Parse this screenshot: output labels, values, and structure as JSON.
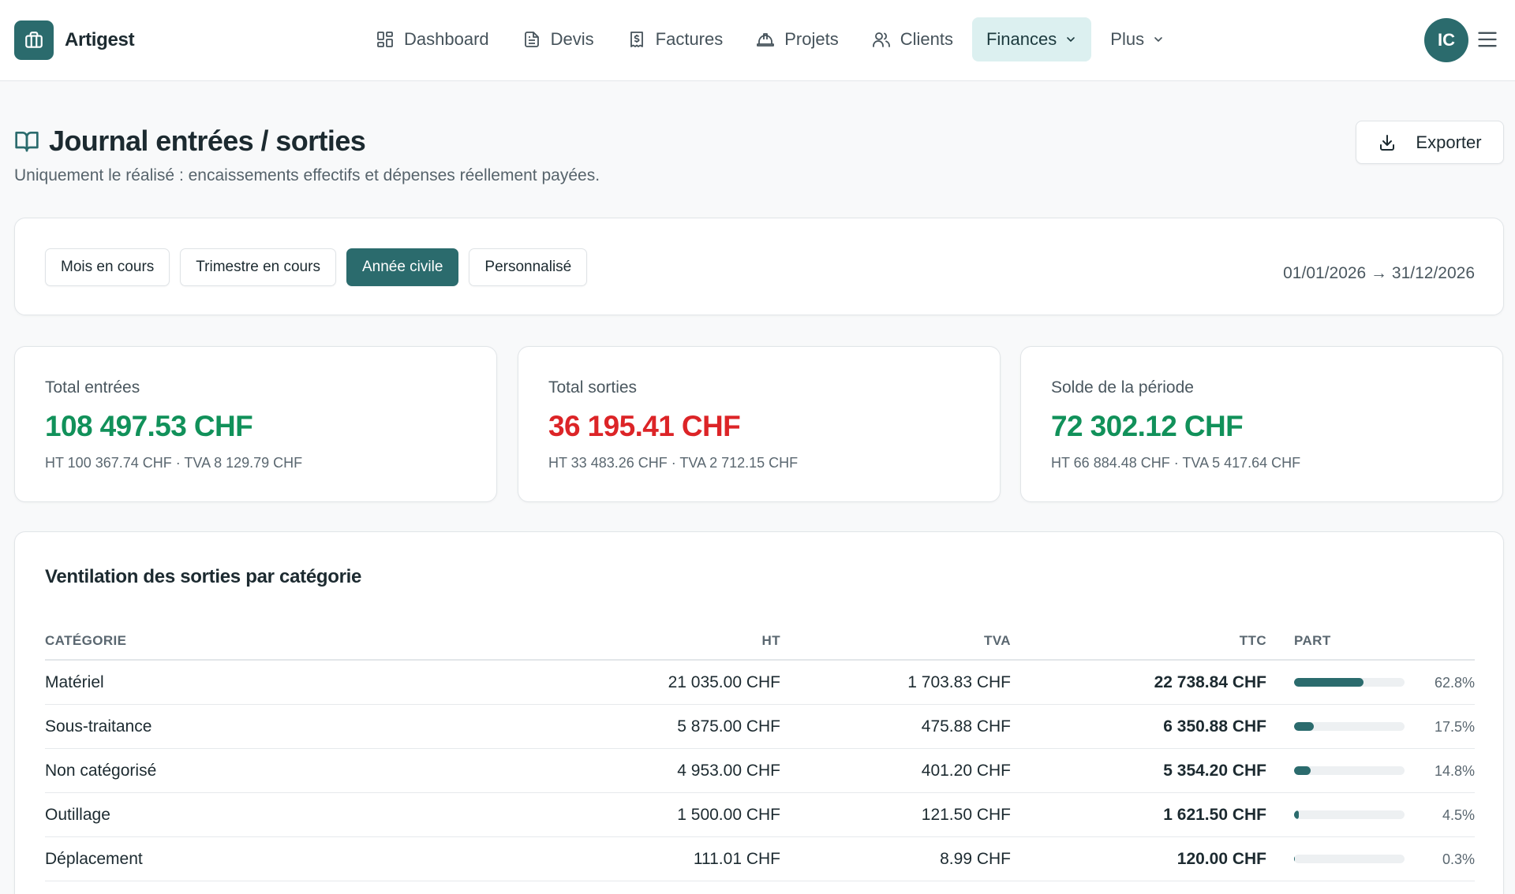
{
  "brand": {
    "name": "Artigest"
  },
  "nav": {
    "items": [
      {
        "label": "Dashboard"
      },
      {
        "label": "Devis"
      },
      {
        "label": "Factures"
      },
      {
        "label": "Projets"
      },
      {
        "label": "Clients"
      },
      {
        "label": "Finances"
      },
      {
        "label": "Plus"
      }
    ]
  },
  "user": {
    "initials": "IC"
  },
  "header": {
    "title": "Journal entrées / sorties",
    "subtitle": "Uniquement le réalisé : encaissements effectifs et dépenses réellement payées.",
    "export_label": "Exporter"
  },
  "period": {
    "options": [
      "Mois en cours",
      "Trimestre en cours",
      "Année civile",
      "Personnalisé"
    ],
    "selected": "Année civile",
    "range": "01/01/2026 → 31/12/2026"
  },
  "stats": {
    "entrees": {
      "label": "Total entrées",
      "value": "108 497.53 CHF",
      "detail": "HT 100 367.74 CHF · TVA 8 129.79 CHF"
    },
    "sorties": {
      "label": "Total sorties",
      "value": "36 195.41 CHF",
      "detail": "HT 33 483.26 CHF · TVA 2 712.15 CHF"
    },
    "solde": {
      "label": "Solde de la période",
      "value": "72 302.12 CHF",
      "detail": "HT 66 884.48 CHF · TVA 5 417.64 CHF"
    }
  },
  "breakdown": {
    "title": "Ventilation des sorties par catégorie",
    "columns": {
      "category": "CATÉGORIE",
      "ht": "HT",
      "tva": "TVA",
      "ttc": "TTC",
      "part": "PART"
    },
    "rows": [
      {
        "category": "Matériel",
        "ht": "21 035.00 CHF",
        "tva": "1 703.83 CHF",
        "ttc": "22 738.84 CHF",
        "part": "62.8%",
        "share": 0.628
      },
      {
        "category": "Sous-traitance",
        "ht": "5 875.00 CHF",
        "tva": "475.88 CHF",
        "ttc": "6 350.88 CHF",
        "part": "17.5%",
        "share": 0.175
      },
      {
        "category": "Non catégorisé",
        "ht": "4 953.00 CHF",
        "tva": "401.20 CHF",
        "ttc": "5 354.20 CHF",
        "part": "14.8%",
        "share": 0.148
      },
      {
        "category": "Outillage",
        "ht": "1 500.00 CHF",
        "tva": "121.50 CHF",
        "ttc": "1 621.50 CHF",
        "part": "4.5%",
        "share": 0.045
      },
      {
        "category": "Déplacement",
        "ht": "111.01 CHF",
        "tva": "8.99 CHF",
        "ttc": "120.00 CHF",
        "part": "0.3%",
        "share": 0.003
      }
    ]
  },
  "colors": {
    "accent": "#2b6b6d",
    "positive": "#11915a",
    "negative": "#dc2427",
    "nav_active_bg": "#dcf0f0"
  },
  "icons": {
    "brand": "briefcase-icon",
    "dashboard": "layout-grid-icon",
    "devis": "file-text-icon",
    "factures": "receipt-icon",
    "projets": "hard-hat-icon",
    "clients": "users-icon",
    "chevron": "chevron-down-icon",
    "menu": "menu-icon",
    "title": "book-open-icon",
    "export": "download-icon"
  }
}
